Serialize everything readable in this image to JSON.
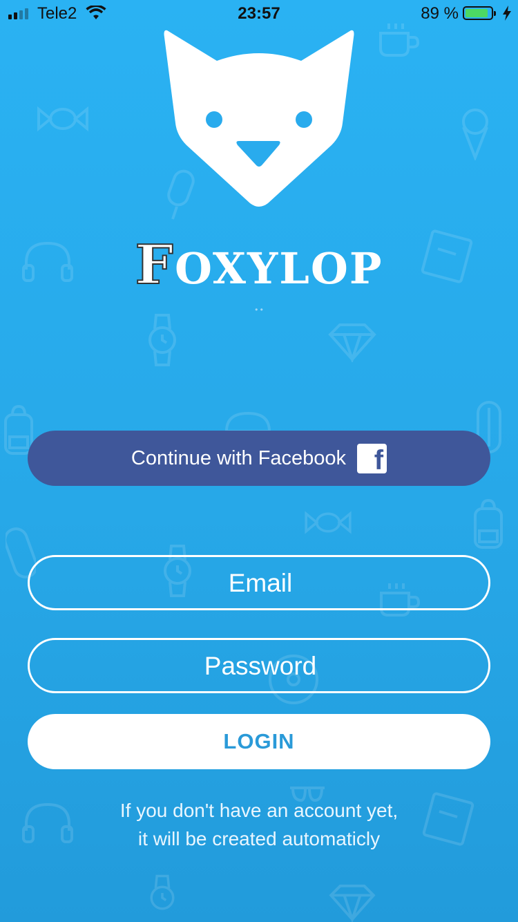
{
  "status_bar": {
    "carrier": "Tele2",
    "time": "23:57",
    "battery_percent": "89 %",
    "battery_level": 0.89,
    "battery_color": "#4cd964"
  },
  "app": {
    "logo_icon": "fox-head-icon",
    "brand_first_letter": "F",
    "brand_rest": "OXYLOP",
    "page_indicator": "• •"
  },
  "facebook_button": {
    "label": "Continue with Facebook",
    "icon": "facebook-icon",
    "color": "#3f579a"
  },
  "form": {
    "email_placeholder": "Email",
    "password_placeholder": "Password",
    "login_label": "LOGIN"
  },
  "footer": {
    "line1": "If you don't have an account yet,",
    "line2": "it will be created automaticly"
  },
  "background_icons": [
    "candy-icon",
    "coffee-cup-icon",
    "ice-cream-icon",
    "popsicle-icon",
    "headphones-icon",
    "clothes-icon",
    "watch-icon",
    "diamond-icon",
    "backpack-icon",
    "hat-icon",
    "hotdog-icon",
    "disc-icon",
    "sunglasses-icon"
  ],
  "colors": {
    "background": "#2ab2f3",
    "login_text": "#2a9ad8"
  }
}
